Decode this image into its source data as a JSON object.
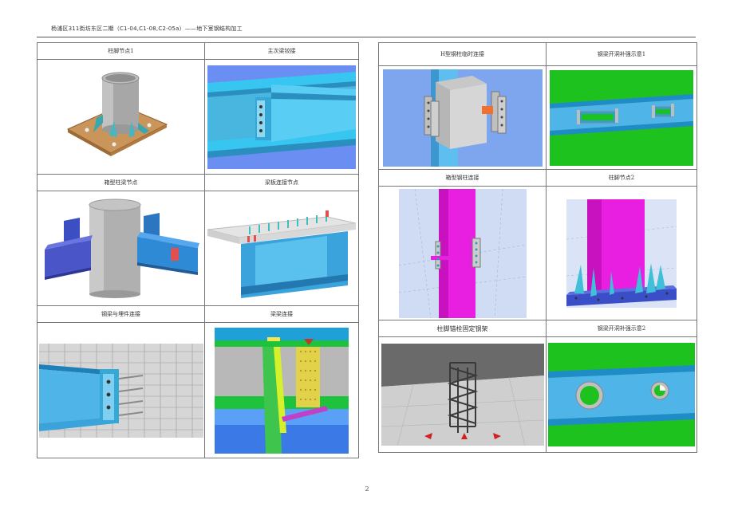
{
  "header": {
    "title": "杨浦区311街坊东区二期（C1-04,C1-08,C2-05a）——地下室钢结构加工"
  },
  "left_table": {
    "rows": [
      {
        "captions": [
          "柱脚节点1",
          "主次梁铰接"
        ]
      },
      {
        "captions": [
          "箱型柱梁节点",
          "梁板连接节点"
        ]
      },
      {
        "captions": [
          "钢梁与埋件连接",
          "梁梁连接"
        ]
      }
    ]
  },
  "right_table": {
    "rows": [
      {
        "captions": [
          "H型钢柱临时连接",
          "钢梁开洞补强示意1"
        ]
      },
      {
        "captions": [
          "箱型钢柱连接",
          "柱脚节点2"
        ]
      },
      {
        "captions": [
          "柱脚锚栓固定钢架",
          "钢梁开洞补强示意2"
        ]
      }
    ]
  },
  "page_number": "2"
}
